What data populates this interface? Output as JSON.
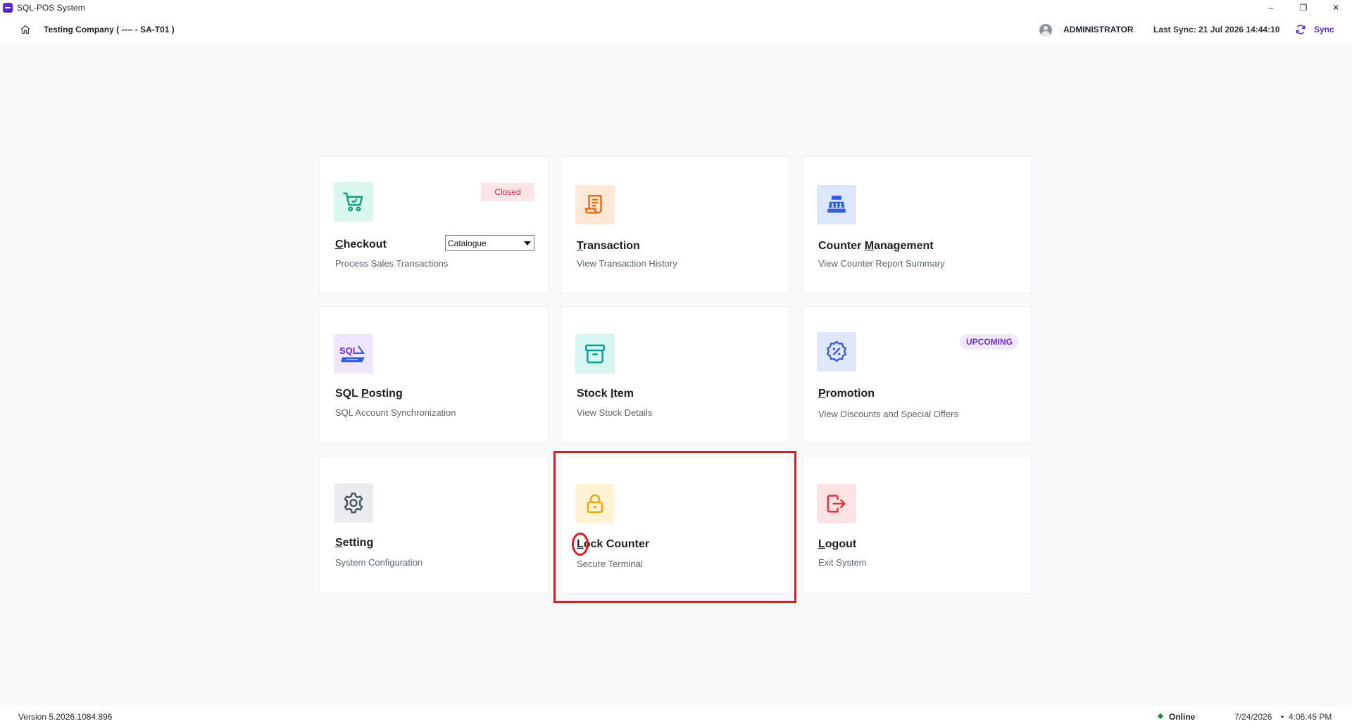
{
  "window": {
    "title": "SQL-POS System",
    "controls": {
      "minimize": "–",
      "restore": "❐",
      "close": "✕"
    }
  },
  "header": {
    "company": "Testing Company ( ---- - SA-T01 )",
    "user": "ADMINISTRATOR",
    "last_sync": "Last Sync: 21 Jul 2026 14:44:10",
    "sync_label": "Sync"
  },
  "tiles": {
    "checkout": {
      "title_underlined": "C",
      "title_rest": "heckout",
      "subtitle": "Process Sales Transactions",
      "badge": "Closed",
      "dropdown_value": "Catalogue",
      "icon": "shopping-cart-icon",
      "color": "#10a37f"
    },
    "transaction": {
      "title_underlined": "T",
      "title_rest": "ransaction",
      "subtitle": "View Transaction History",
      "icon": "receipt-icon",
      "color": "#e8680f"
    },
    "counter_management": {
      "title_before": "Counter ",
      "title_underlined": "M",
      "title_rest": "anagement",
      "subtitle": "View Counter Report Summary",
      "icon": "cash-register-icon",
      "color": "#2f5ee0"
    },
    "sql_posting": {
      "title_before": "SQL ",
      "title_underlined": "P",
      "title_rest": "osting",
      "subtitle": "SQL Account Synchronization",
      "icon": "sql-account-logo-icon",
      "logo_text": "SQL",
      "color": "#6a2fd8"
    },
    "stock_item": {
      "title_before": "Stock ",
      "title_underlined": "I",
      "title_rest": "tem",
      "subtitle": "View Stock Details",
      "icon": "archive-box-icon",
      "color": "#12a197"
    },
    "promotion": {
      "title_underlined": "P",
      "title_rest": "romotion",
      "subtitle": "View Discounts and Special Offers",
      "badge": "UPCOMING",
      "icon": "discount-badge-icon",
      "color": "#3b5bd6"
    },
    "setting": {
      "title_underlined": "S",
      "title_rest": "etting",
      "subtitle": "System Configuration",
      "icon": "gear-icon",
      "color": "#4b5563"
    },
    "lock_counter": {
      "title_underlined": "L",
      "title_rest": "ock Counter",
      "subtitle": "Secure Terminal",
      "icon": "lock-icon",
      "color": "#e8a80f"
    },
    "logout": {
      "title_underlined": "L",
      "title_rest": "ogout",
      "subtitle": "Exit System",
      "icon": "logout-icon",
      "color": "#e0343f"
    }
  },
  "footer": {
    "version": "Version 5.2026.1084.896",
    "status": "Online",
    "date": "7/24/2026",
    "separator": "•",
    "time": "4:06:45 PM"
  }
}
